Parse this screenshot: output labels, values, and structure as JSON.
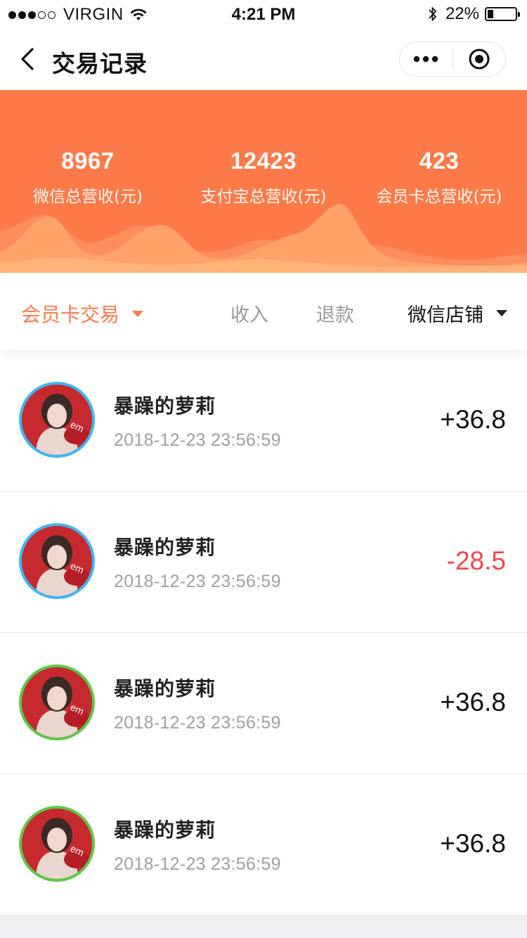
{
  "status_bar": {
    "carrier": "VIRGIN",
    "time": "4:21 PM",
    "battery": "22%",
    "battery_level": 0.22,
    "signal_bars": 3,
    "signal_total": 5
  },
  "nav": {
    "title": "交易记录",
    "back_icon": "chevron-left-icon",
    "more_icon": "more-dots-icon",
    "close_icon": "target-circle-icon"
  },
  "summary": {
    "stats": [
      {
        "value": "8967",
        "label": "微信总营收(元)"
      },
      {
        "value": "12423",
        "label": "支付宝总营收(元)"
      },
      {
        "value": "423",
        "label": "会员卡总营收(元)"
      }
    ]
  },
  "filter": {
    "type_label": "会员卡交易",
    "tabs": [
      {
        "label": "收入"
      },
      {
        "label": "退款"
      }
    ],
    "store_label": "微信店铺"
  },
  "transactions": [
    {
      "name": "暴躁的萝莉",
      "time": "2018-12-23 23:56:59",
      "amount": "+36.8",
      "ring": "blue"
    },
    {
      "name": "暴躁的萝莉",
      "time": "2018-12-23 23:56:59",
      "amount": "-28.5",
      "ring": "blue"
    },
    {
      "name": "暴躁的萝莉",
      "time": "2018-12-23 23:56:59",
      "amount": "+36.8",
      "ring": "green"
    },
    {
      "name": "暴躁的萝莉",
      "time": "2018-12-23 23:56:59",
      "amount": "+36.8",
      "ring": "green"
    }
  ],
  "colors": {
    "accent": "#ff7a49",
    "negative": "#f5474c",
    "ring_blue": "#3db6f5",
    "ring_green": "#5cc84a"
  }
}
